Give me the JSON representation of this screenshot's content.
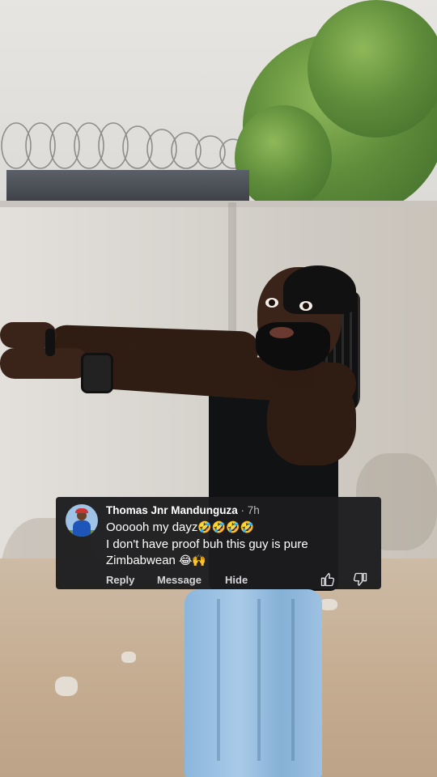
{
  "comment": {
    "username": "Thomas Jnr Mandunguza",
    "separator": " · ",
    "time": "7h",
    "lines": [
      {
        "text": "Oooooh my dayz",
        "emoji": "🤣🤣🤣🤣"
      },
      {
        "text": "I don't have proof buh this guy is pure",
        "emoji": ""
      },
      {
        "text": "Zimbabwean ",
        "emoji": "😂🙌"
      }
    ],
    "actions": {
      "reply": "Reply",
      "message": "Message",
      "hide": "Hide"
    },
    "icons": {
      "avatar": "user-avatar",
      "like": "thumbs-up-icon",
      "dislike": "thumbs-down-icon"
    }
  },
  "colors": {
    "overlay_bg": "#1c1c1e",
    "text": "#ffffff",
    "muted": "#b9b9be"
  }
}
